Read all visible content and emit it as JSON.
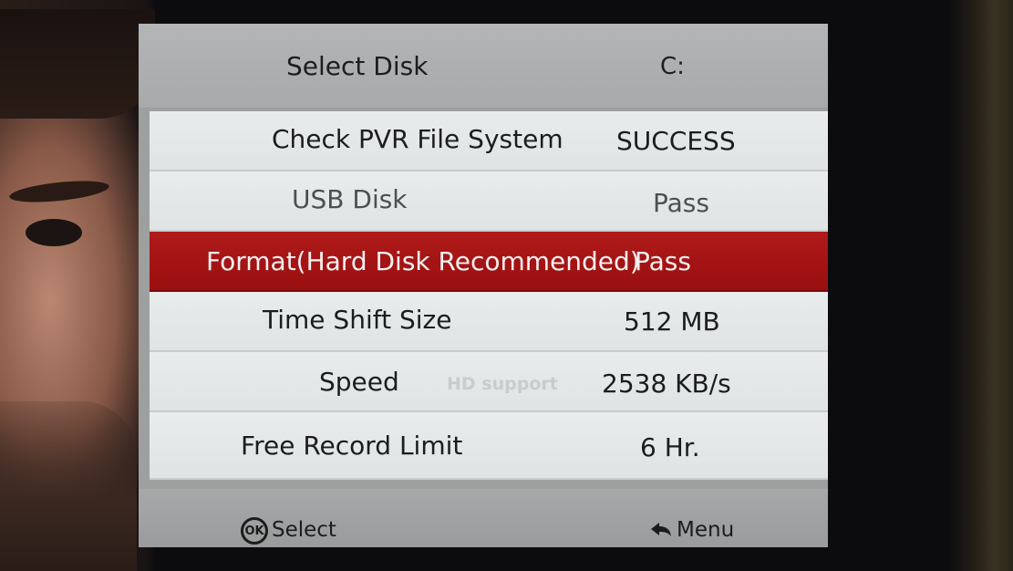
{
  "menu": {
    "header": {
      "label": "Select Disk",
      "value": "C:"
    },
    "rows": [
      {
        "label": "Check PVR File System",
        "value": "SUCCESS"
      },
      {
        "label": "USB Disk",
        "value": "Pass"
      },
      {
        "label": "Format(Hard Disk Recommended)",
        "value": "Pass",
        "selected": true
      },
      {
        "label": "Time Shift Size",
        "value": "512 MB"
      },
      {
        "label": "Speed",
        "badge": "HD support",
        "value": "2538 KB/s"
      },
      {
        "label": "Free Record Limit",
        "value": "6 Hr."
      }
    ],
    "footer": {
      "ok_icon": "OK",
      "select_label": "Select",
      "menu_label": "Menu",
      "back_icon": "return-arrow-icon"
    }
  },
  "colors": {
    "panel": "#9e9f9f",
    "row": "#e9ecec",
    "selected_row": "#b01a1a"
  }
}
